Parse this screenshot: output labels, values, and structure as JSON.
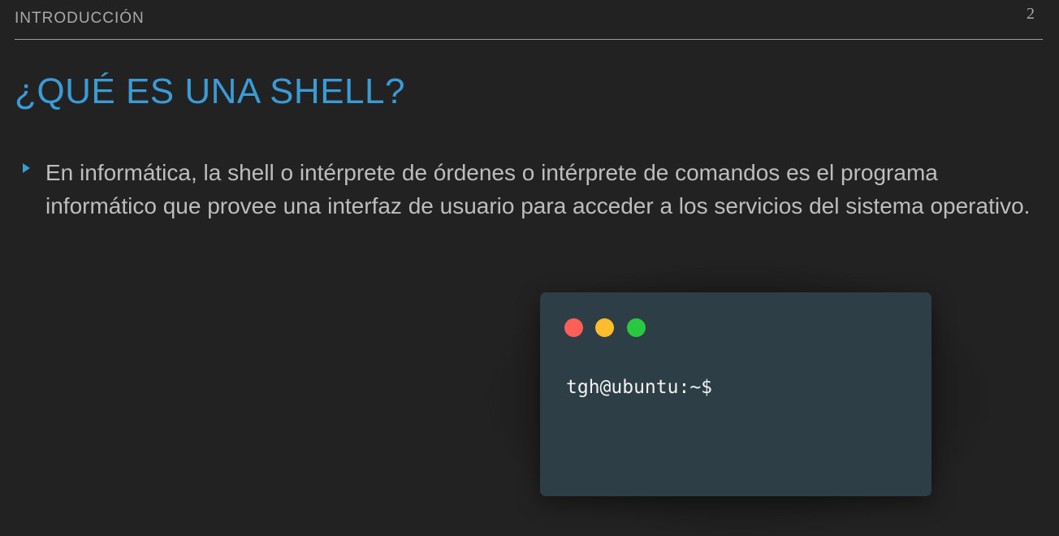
{
  "header": {
    "section": "INTRODUCCIÓN",
    "page_number": "2"
  },
  "slide": {
    "title": "¿QUÉ ES UNA SHELL?",
    "bullets": [
      "En informática, la shell o intérprete de órdenes o intérprete de comandos es el programa informático que provee una interfaz de usuario para acceder a los servicios del sistema operativo."
    ]
  },
  "terminal": {
    "prompt": "tgh@ubuntu:~$",
    "buttons": [
      {
        "name": "close-dot",
        "color": "#ff5f57"
      },
      {
        "name": "minimize-dot",
        "color": "#ffbd2e"
      },
      {
        "name": "maximize-dot",
        "color": "#28c940"
      }
    ]
  },
  "colors": {
    "accent": "#3a9bd6",
    "background": "#222222",
    "terminal_background": "#2d3e47",
    "text": "#bdbdbd"
  }
}
